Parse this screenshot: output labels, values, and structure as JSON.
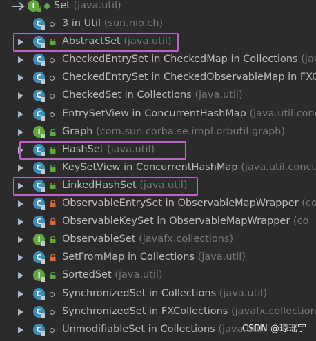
{
  "root": {
    "name": "Set",
    "package": "(java.util)"
  },
  "rows": [
    {
      "name": "3 in Util",
      "package": "(sun.nio.ch)",
      "icon": "class",
      "vis": "pkg",
      "expandable": false,
      "highlight": false
    },
    {
      "name": "AbstractSet",
      "package": "(java.util)",
      "icon": "abstract-class",
      "vis": "pub",
      "expandable": true,
      "highlight": true
    },
    {
      "name": "CheckedEntrySet in CheckedMap in Collections",
      "package": "(java.u",
      "icon": "class",
      "vis": "pkg",
      "expandable": true,
      "highlight": false
    },
    {
      "name": "CheckedEntrySet in CheckedObservableMap in FXC",
      "package": "",
      "icon": "class",
      "vis": "pkg",
      "expandable": true,
      "highlight": false
    },
    {
      "name": "CheckedSet in Collections",
      "package": "(java.util)",
      "icon": "class",
      "vis": "pkg",
      "expandable": true,
      "highlight": false
    },
    {
      "name": "EntrySetView in ConcurrentHashMap",
      "package": "(java.util.conc",
      "icon": "class",
      "vis": "pkg",
      "expandable": true,
      "highlight": false
    },
    {
      "name": "Graph",
      "package": "(com.sun.corba.se.impl.orbutil.graph)",
      "icon": "interface",
      "vis": "pub",
      "expandable": true,
      "highlight": false
    },
    {
      "name": "HashSet",
      "package": "(java.util)",
      "icon": "class",
      "vis": "pub",
      "expandable": true,
      "highlight": true
    },
    {
      "name": "KeySetView in ConcurrentHashMap",
      "package": "(java.util.concu",
      "icon": "class",
      "vis": "pub",
      "expandable": true,
      "highlight": false
    },
    {
      "name": "LinkedHashSet",
      "package": "(java.util)",
      "icon": "class",
      "vis": "pub",
      "expandable": true,
      "highlight": true
    },
    {
      "name": "ObservableEntrySet in ObservableMapWrapper",
      "package": "(co",
      "icon": "class",
      "vis": "priv",
      "expandable": true,
      "highlight": false
    },
    {
      "name": "ObservableKeySet in ObservableMapWrapper",
      "package": "(co",
      "icon": "class",
      "vis": "priv",
      "expandable": true,
      "highlight": false
    },
    {
      "name": "ObservableSet",
      "package": "(javafx.collections)",
      "icon": "interface",
      "vis": "pub",
      "expandable": true,
      "highlight": false
    },
    {
      "name": "SetFromMap in Collections",
      "package": "(java.util)",
      "icon": "class",
      "vis": "priv",
      "expandable": true,
      "highlight": false
    },
    {
      "name": "SortedSet",
      "package": "(java.util)",
      "icon": "interface",
      "vis": "pub",
      "expandable": true,
      "highlight": false
    },
    {
      "name": "SynchronizedSet in Collections",
      "package": "(java.util)",
      "icon": "class",
      "vis": "pkg",
      "expandable": true,
      "highlight": false
    },
    {
      "name": "SynchronizedSet in FXCollections",
      "package": "(javafx.collection",
      "icon": "class",
      "vis": "pkg",
      "expandable": true,
      "highlight": false
    },
    {
      "name": "UnmodifiableSet in Collections",
      "package": "(java.util)",
      "icon": "class",
      "vis": "pkg",
      "expandable": true,
      "highlight": false
    }
  ],
  "watermark": "CSDN @琼瑶宇",
  "colors": {
    "background": "#2b2b2b",
    "text": "#bbbbbb",
    "package_text": "#787878",
    "class_icon": "#3d8fb6",
    "interface_icon": "#62a742",
    "highlight_border": "#c060c8",
    "private_lock": "#d9692e",
    "public_lock": "#62a742"
  }
}
